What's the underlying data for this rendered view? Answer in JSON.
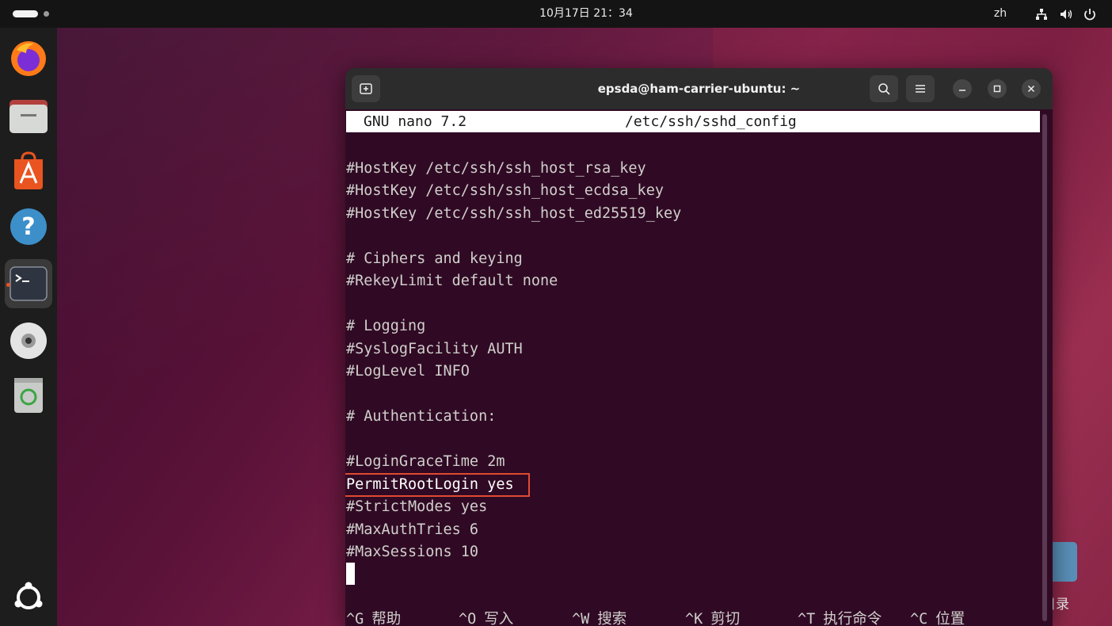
{
  "topbar": {
    "clock": "10月17日  21：34",
    "language": "zh",
    "tray_icons": [
      "network-icon",
      "volume-icon",
      "power-icon"
    ]
  },
  "dock": {
    "items": [
      {
        "name": "Firefox",
        "icon": "firefox-icon"
      },
      {
        "name": "Files",
        "icon": "files-icon"
      },
      {
        "name": "App Center",
        "icon": "app-center-icon"
      },
      {
        "name": "Help",
        "icon": "help-icon"
      },
      {
        "name": "Terminal",
        "icon": "terminal-icon",
        "active": true
      },
      {
        "name": "Disc",
        "icon": "disc-icon"
      },
      {
        "name": "Trash",
        "icon": "trash-icon"
      }
    ],
    "apps_grid_icon": "ubuntu-logo-icon"
  },
  "desktop": {
    "folder_label": "目录"
  },
  "terminal": {
    "title": "epsda@ham-carrier-ubuntu: ~",
    "nano_header": {
      "version": "GNU nano 7.2",
      "filename": "/etc/ssh/sshd_config"
    },
    "lines": [
      "#HostKey /etc/ssh/ssh_host_rsa_key",
      "#HostKey /etc/ssh/ssh_host_ecdsa_key",
      "#HostKey /etc/ssh/ssh_host_ed25519_key",
      "# Ciphers and keying",
      "#RekeyLimit default none",
      "# Logging",
      "#SyslogFacility AUTH",
      "#LogLevel INFO",
      "# Authentication:",
      "#LoginGraceTime 2m",
      "PermitRootLogin yes",
      "#StrictModes yes",
      "#MaxAuthTries 6",
      "#MaxSessions 10"
    ],
    "shortcuts": [
      {
        "key": "^G",
        "label": "帮助"
      },
      {
        "key": "^O",
        "label": "写入"
      },
      {
        "key": "^W",
        "label": "搜索"
      },
      {
        "key": "^K",
        "label": "剪切"
      },
      {
        "key": "^T",
        "label": "执行命令"
      },
      {
        "key": "^C",
        "label": "位置"
      }
    ]
  },
  "colors": {
    "terminal_bg": "#300a24",
    "highlight_border": "#e04a32",
    "accent": "#e95420"
  }
}
